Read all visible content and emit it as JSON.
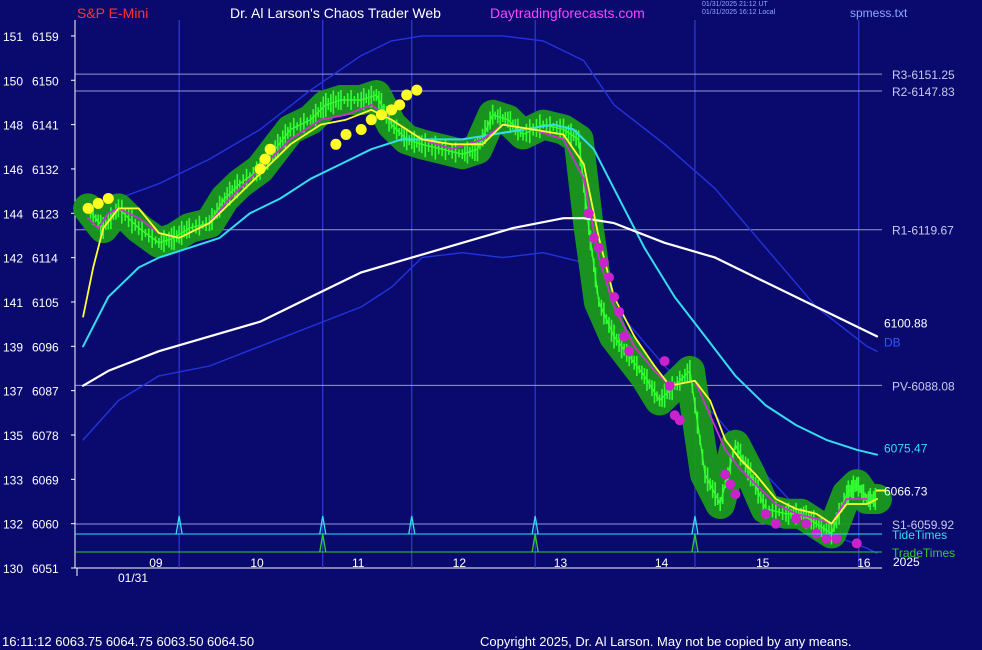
{
  "header": {
    "symbol": "S&P E-Mini",
    "title": "Dr. Al Larson's Chaos Trader Web",
    "site": "Daytradingforecasts.com",
    "timestamp_utc": "01/31/2025 21:12 UT",
    "timestamp_local": "01/31/2025 16:12 Local",
    "file": "spmess.txt"
  },
  "footer": {
    "quote": "16:11:12  6063.75 6064.75 6063.50 6064.50",
    "copyright": "Copyright 2025, Dr. Al Larson. May not be copied by any means."
  },
  "colors": {
    "background": "#0a0a6e",
    "price_line": "#33ff33",
    "price_glow": "#1a9a1a",
    "fast_avg": "#ffff33",
    "mid_avg": "#cc33cc",
    "ema_cyan": "#33ddee",
    "slow_avg": "#ffffff",
    "envelope": "#2233dd",
    "level_line": "#bbbbee",
    "tide": "#33ddee",
    "trade": "#33cc33"
  },
  "chart_data": {
    "type": "line",
    "title": "S&P E-Mini",
    "ylim": [
      6051,
      6160
    ],
    "xlim": [
      8.2,
      16.1
    ],
    "grid": "vertical dashed at event times",
    "y_ticks": [
      {
        "left": "151",
        "right": "6159"
      },
      {
        "left": "150",
        "right": "6150"
      },
      {
        "left": "148",
        "right": "6141"
      },
      {
        "left": "146",
        "right": "6132"
      },
      {
        "left": "144",
        "right": "6123"
      },
      {
        "left": "142",
        "right": "6114"
      },
      {
        "left": "141",
        "right": "6105"
      },
      {
        "left": "139",
        "right": "6096"
      },
      {
        "left": "137",
        "right": "6087"
      },
      {
        "left": "135",
        "right": "6078"
      },
      {
        "left": "133",
        "right": "6069"
      },
      {
        "left": "132",
        "right": "6060"
      },
      {
        "left": "130",
        "right": "6051"
      }
    ],
    "x_ticks": [
      {
        "label": "09",
        "x": 9
      },
      {
        "label": "10",
        "x": 10
      },
      {
        "label": "11",
        "x": 11
      },
      {
        "label": "12",
        "x": 12
      },
      {
        "label": "13",
        "x": 13
      },
      {
        "label": "14",
        "x": 14
      },
      {
        "label": "15",
        "x": 15
      },
      {
        "label": "16",
        "x": 16
      }
    ],
    "date_label": "01/31",
    "year_label": "2025",
    "levels": [
      {
        "name": "R3",
        "label": "R3-6151.25",
        "value": 6151.25
      },
      {
        "name": "R2",
        "label": "R2-6147.83",
        "value": 6147.83
      },
      {
        "name": "R1",
        "label": "R1-6119.67",
        "value": 6119.67
      },
      {
        "name": "PV",
        "label": "PV-6088.08",
        "value": 6088.08
      },
      {
        "name": "S1",
        "label": "S1-6059.92",
        "value": 6059.92
      }
    ],
    "end_labels": [
      {
        "label": "6100.88",
        "series": "slow_avg",
        "value": 6100.88
      },
      {
        "label": "DB",
        "series": "envelope",
        "value": 6097
      },
      {
        "label": "6075.47",
        "series": "ema_cyan",
        "value": 6075.47
      },
      {
        "label": "6066.73",
        "series": "fast_avg",
        "value": 6066.73
      }
    ],
    "event_rows": [
      {
        "name": "TideTimes",
        "label": "TideTimes",
        "times": [
          9.2,
          10.62,
          11.5,
          12.72,
          14.3
        ]
      },
      {
        "name": "TradeTimes",
        "label": "TradeTimes",
        "times": [
          10.62,
          12.72,
          14.3
        ]
      }
    ],
    "vertical_lines": [
      9.2,
      10.62,
      11.5,
      12.72,
      14.3,
      15.92
    ],
    "series": [
      {
        "name": "price",
        "x": [
          8.3,
          8.45,
          8.6,
          8.8,
          9.0,
          9.15,
          9.3,
          9.5,
          9.65,
          9.8,
          10.0,
          10.15,
          10.3,
          10.5,
          10.65,
          10.8,
          11.0,
          11.15,
          11.3,
          11.45,
          11.6,
          11.8,
          12.0,
          12.15,
          12.3,
          12.45,
          12.6,
          12.8,
          13.0,
          13.15,
          13.25,
          13.35,
          13.5,
          13.65,
          13.8,
          13.95,
          14.1,
          14.25,
          14.4,
          14.55,
          14.7,
          14.85,
          15.0,
          15.2,
          15.35,
          15.5,
          15.65,
          15.8,
          15.9,
          16.0,
          16.1
        ],
        "y": [
          6124,
          6120,
          6124,
          6120,
          6117,
          6118,
          6120,
          6121,
          6126,
          6129,
          6132,
          6136,
          6140,
          6142,
          6145,
          6146,
          6146,
          6147,
          6141,
          6138,
          6137,
          6136,
          6135,
          6136,
          6143,
          6142,
          6139,
          6141,
          6140,
          6138,
          6120,
          6105,
          6098,
          6094,
          6090,
          6085,
          6088,
          6091,
          6070,
          6064,
          6076,
          6070,
          6063,
          6062,
          6062,
          6060,
          6058,
          6066,
          6068,
          6065,
          6065
        ]
      },
      {
        "name": "fast_avg",
        "x": [
          8.25,
          8.35,
          8.45,
          8.6,
          8.8,
          9.0,
          9.2,
          9.5,
          9.7,
          10.0,
          10.3,
          10.6,
          10.85,
          11.1,
          11.3,
          11.6,
          11.9,
          12.2,
          12.4,
          12.7,
          13.0,
          13.2,
          13.35,
          13.5,
          13.7,
          13.9,
          14.05,
          14.3,
          14.45,
          14.6,
          14.75,
          14.9,
          15.1,
          15.3,
          15.5,
          15.65,
          15.8,
          16.0,
          16.1
        ],
        "y": [
          6102,
          6112,
          6120,
          6124,
          6124,
          6119,
          6118,
          6121,
          6125,
          6131,
          6137,
          6141,
          6142,
          6144,
          6142,
          6138,
          6137,
          6137,
          6141,
          6140,
          6139,
          6133,
          6118,
          6106,
          6098,
          6092,
          6088,
          6089,
          6085,
          6077,
          6073,
          6070,
          6065,
          6063,
          6062,
          6060,
          6064,
          6064,
          6065
        ]
      },
      {
        "name": "mid_avg",
        "x": [
          8.3,
          8.4,
          8.5,
          8.6,
          8.8,
          9.0,
          9.2,
          9.5,
          9.7,
          10.0,
          10.3,
          10.6,
          10.85,
          11.1,
          11.3,
          11.6,
          11.9,
          12.2,
          12.4,
          12.7,
          13.0,
          13.2,
          13.35,
          13.5,
          13.7,
          13.9,
          14.05,
          14.3,
          14.45,
          14.6,
          14.75,
          14.9,
          15.1,
          15.3,
          15.5,
          15.65,
          15.8,
          16.0
        ],
        "y": [
          6122,
          6120,
          6123,
          6124,
          6122,
          6119,
          6118,
          6121,
          6126,
          6132,
          6138,
          6142,
          6143,
          6145,
          6142,
          6138,
          6136,
          6138,
          6141,
          6140,
          6138,
          6130,
          6114,
          6104,
          6096,
          6091,
          6088,
          6089,
          6082,
          6075,
          6071,
          6068,
          6064,
          6062,
          6061,
          6060,
          6065,
          6065
        ]
      },
      {
        "name": "ema_cyan",
        "x": [
          8.25,
          8.5,
          8.8,
          9.0,
          9.3,
          9.6,
          9.9,
          10.2,
          10.5,
          10.8,
          11.1,
          11.4,
          11.7,
          12.0,
          12.3,
          12.6,
          12.9,
          13.1,
          13.3,
          13.5,
          13.8,
          14.1,
          14.4,
          14.7,
          15.0,
          15.3,
          15.6,
          15.9,
          16.1
        ],
        "y": [
          6096,
          6106,
          6112,
          6114,
          6116,
          6118,
          6123,
          6126,
          6130,
          6133,
          6136,
          6138,
          6138,
          6138,
          6139,
          6140,
          6141,
          6140,
          6136,
          6128,
          6116,
          6106,
          6098,
          6090,
          6084,
          6080,
          6077,
          6075,
          6074
        ]
      },
      {
        "name": "slow_avg",
        "x": [
          8.25,
          8.5,
          9.0,
          9.5,
          10.0,
          10.5,
          11.0,
          11.5,
          12.0,
          12.5,
          13.0,
          13.2,
          13.5,
          14.0,
          14.5,
          15.0,
          15.5,
          16.0,
          16.1
        ],
        "y": [
          6088,
          6091,
          6095,
          6098,
          6101,
          6106,
          6111,
          6114,
          6117,
          6120,
          6122,
          6122,
          6121,
          6117,
          6114,
          6109,
          6104,
          6099,
          6098
        ]
      },
      {
        "name": "envelope_upper",
        "x": [
          8.25,
          8.6,
          9.0,
          9.5,
          10.0,
          10.5,
          11.0,
          11.3,
          11.6,
          12.0,
          12.4,
          12.8,
          13.2,
          13.5,
          14.0,
          14.5,
          15.0,
          15.5,
          16.0,
          16.1
        ],
        "y": [
          6120,
          6126,
          6129,
          6134,
          6140,
          6148,
          6155,
          6158,
          6159,
          6159,
          6159,
          6158,
          6154,
          6145,
          6137,
          6128,
          6116,
          6104,
          6096,
          6095
        ]
      },
      {
        "name": "envelope_lower",
        "x": [
          8.25,
          8.6,
          9.0,
          9.5,
          10.0,
          10.5,
          11.0,
          11.3,
          11.6,
          12.0,
          12.4,
          12.8,
          13.2,
          13.5,
          14.0,
          14.5,
          15.0,
          15.5,
          16.0,
          16.1
        ],
        "y": [
          6077,
          6085,
          6090,
          6092,
          6096,
          6100,
          6104,
          6108,
          6114,
          6115,
          6114,
          6115,
          6113,
          6104,
          6092,
          6082,
          6070,
          6059,
          6055,
          6054
        ]
      }
    ],
    "markers_yellow": [
      [
        8.3,
        6124
      ],
      [
        8.4,
        6125
      ],
      [
        8.5,
        6126
      ],
      [
        10.75,
        6137
      ],
      [
        10.85,
        6139
      ],
      [
        11.0,
        6140
      ],
      [
        11.1,
        6142
      ],
      [
        11.2,
        6143
      ],
      [
        11.3,
        6144
      ],
      [
        11.38,
        6145
      ],
      [
        11.45,
        6147
      ],
      [
        11.55,
        6148
      ],
      [
        10.0,
        6132
      ],
      [
        10.05,
        6134
      ],
      [
        10.1,
        6136
      ]
    ],
    "markers_magenta": [
      [
        13.25,
        6123
      ],
      [
        13.3,
        6118
      ],
      [
        13.35,
        6116
      ],
      [
        13.4,
        6113
      ],
      [
        13.45,
        6110
      ],
      [
        13.5,
        6106
      ],
      [
        13.55,
        6103
      ],
      [
        13.6,
        6098
      ],
      [
        13.65,
        6095
      ],
      [
        14.0,
        6093
      ],
      [
        14.05,
        6088
      ],
      [
        14.1,
        6082
      ],
      [
        14.15,
        6081
      ],
      [
        14.6,
        6070
      ],
      [
        14.65,
        6068
      ],
      [
        14.7,
        6066
      ],
      [
        15.0,
        6062
      ],
      [
        15.1,
        6060
      ],
      [
        15.3,
        6061
      ],
      [
        15.4,
        6060
      ],
      [
        15.5,
        6058
      ],
      [
        15.6,
        6057
      ],
      [
        15.7,
        6057
      ],
      [
        15.9,
        6056
      ]
    ]
  }
}
